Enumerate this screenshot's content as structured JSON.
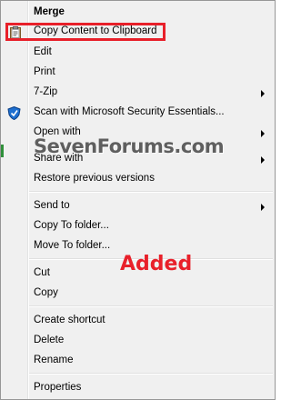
{
  "menu": {
    "items": [
      {
        "label": "Merge"
      },
      {
        "label": "Copy Content to Clipboard"
      },
      {
        "label": "Edit"
      },
      {
        "label": "Print"
      },
      {
        "label": "7-Zip"
      },
      {
        "label": "Scan with Microsoft Security Essentials..."
      },
      {
        "label": "Open with"
      },
      {
        "label": "Share with"
      },
      {
        "label": "Restore previous versions"
      },
      {
        "label": "Send to"
      },
      {
        "label": "Copy To folder..."
      },
      {
        "label": "Move To folder..."
      },
      {
        "label": "Cut"
      },
      {
        "label": "Copy"
      },
      {
        "label": "Create shortcut"
      },
      {
        "label": "Delete"
      },
      {
        "label": "Rename"
      },
      {
        "label": "Properties"
      }
    ]
  },
  "watermark": "SevenForums.com",
  "annotation": "Added",
  "colors": {
    "highlight_box": "#e8202a",
    "annotation_text": "#e8202a",
    "menu_background": "#f0f0f0"
  },
  "icons": [
    "clipboard-icon",
    "security-shield-icon",
    "submenu-arrow-icon"
  ]
}
